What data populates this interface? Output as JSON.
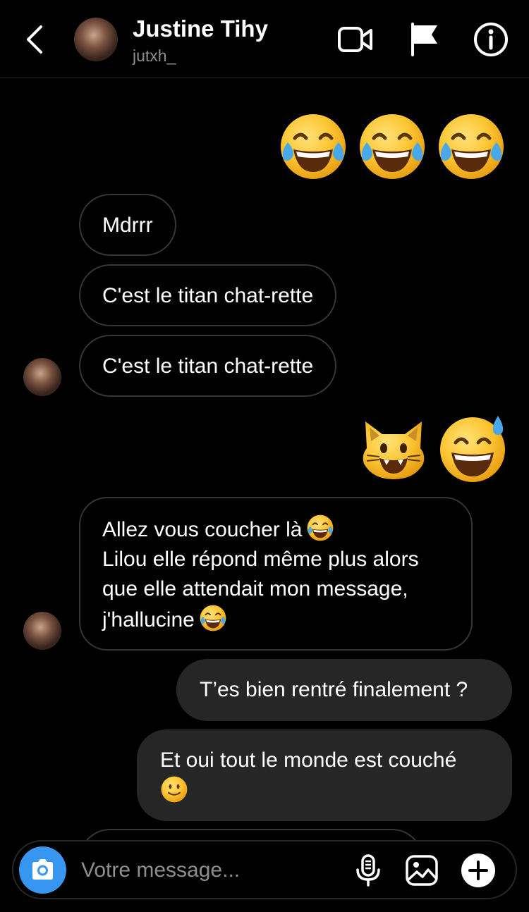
{
  "header": {
    "name": "Justine Tihy",
    "handle": "jutxh_",
    "icons": [
      "back-arrow-icon",
      "video-call-icon",
      "flag-icon",
      "info-icon"
    ]
  },
  "messages": [
    {
      "side": "out",
      "type": "emoji",
      "emoji": [
        "😂",
        "😂",
        "😂"
      ]
    },
    {
      "side": "in",
      "type": "text",
      "lines": [
        "Mdrrr"
      ]
    },
    {
      "side": "in",
      "type": "text",
      "lines": [
        "C'est le titan chat-rette"
      ]
    },
    {
      "side": "in",
      "type": "text",
      "lines": [
        "C'est le titan chat-rette"
      ]
    },
    {
      "side": "out",
      "type": "emoji",
      "emoji": [
        "😸",
        "😅"
      ]
    },
    {
      "side": "in",
      "type": "text",
      "lines": [
        "Allez vous coucher là",
        "Lilou elle répond même plus alors",
        "que elle attendait mon message,",
        "j'hallucine"
      ],
      "inline_emoji": [
        "😂",
        "😂"
      ]
    },
    {
      "side": "out",
      "type": "text",
      "lines": [
        "T’es bien rentré finalement ?"
      ]
    },
    {
      "side": "out",
      "type": "text",
      "lines": [
        "Et oui tout le monde est couché"
      ],
      "inline_emoji": [
        "🙂"
      ]
    }
  ],
  "composer": {
    "placeholder": "Votre message...",
    "icons": [
      "camera-icon",
      "microphone-icon",
      "gallery-icon",
      "plus-icon"
    ]
  },
  "colors": {
    "background": "#000000",
    "incoming_border": "#363636",
    "outgoing_bubble": "#262626",
    "camera_button": "#3797f0",
    "secondary_text": "#8e8e8e"
  }
}
